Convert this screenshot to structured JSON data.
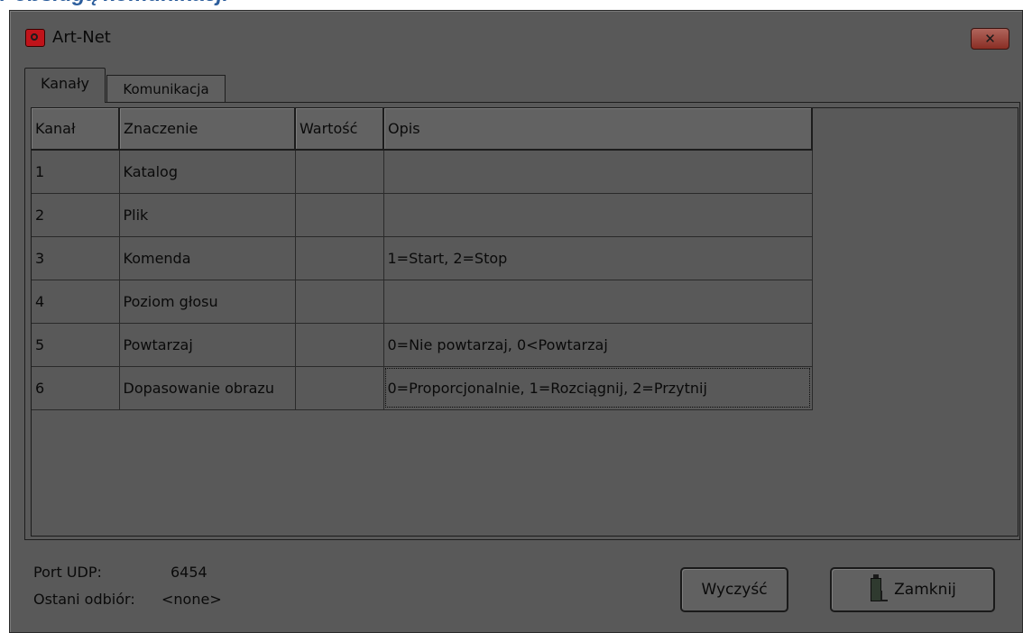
{
  "page": {
    "heading": "r obsługą komunikacji"
  },
  "window": {
    "title": "Art-Net",
    "close_glyph": "✕",
    "icon": "app-logo-icon"
  },
  "tabs": [
    {
      "label": "Kanały",
      "active": true
    },
    {
      "label": "Komunikacja",
      "active": false
    }
  ],
  "table": {
    "columns": [
      "Kanał",
      "Znaczenie",
      "Wartość",
      "Opis"
    ],
    "rows": [
      [
        "1",
        "Katalog",
        "",
        ""
      ],
      [
        "2",
        "Plik",
        "",
        ""
      ],
      [
        "3",
        "Komenda",
        "",
        "1=Start, 2=Stop"
      ],
      [
        "4",
        "Poziom głosu",
        "",
        ""
      ],
      [
        "5",
        "Powtarzaj",
        "",
        "0=Nie powtarzaj, 0<Powtarzaj"
      ],
      [
        "6",
        "Dopasowanie obrazu",
        "",
        "0=Proporcjonalnie, 1=Rozciągnij, 2=Przytnij"
      ]
    ]
  },
  "status": {
    "port_label": "Port UDP:",
    "port_value": "6454",
    "last_label": "Ostani odbiór:",
    "last_value": "<none>"
  },
  "buttons": {
    "clear": "Wyczyść",
    "close": "Zamknij",
    "close_icon": "exit-door-icon"
  },
  "colors": {
    "window_bg": "#595959",
    "heading": "#2b5d9c",
    "close_button": "#8a2e24"
  }
}
